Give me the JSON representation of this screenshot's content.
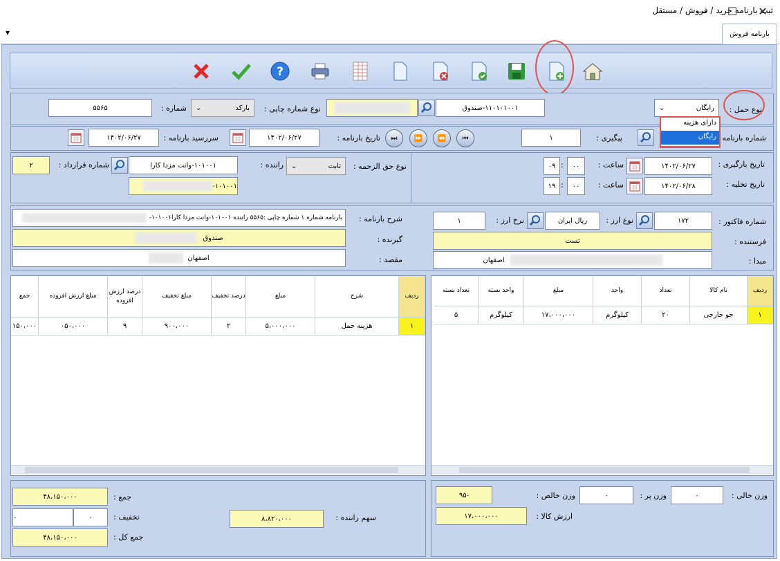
{
  "window": {
    "title": "ثبت بارنامه خرید / فروش / مستقل",
    "minimize": "—",
    "maximize": "☐",
    "close": "✕"
  },
  "tabs": {
    "active": "بارنامه فروش",
    "menu_arrow": "▾"
  },
  "toolbar": {
    "icons": [
      "home-icon",
      "new-document-icon",
      "save-icon",
      "approve-document-icon",
      "delete-document-icon",
      "document-icon",
      "table-icon",
      "print-icon",
      "help-icon",
      "confirm-icon",
      "cancel-icon"
    ]
  },
  "header": {
    "transport_type_label": "نوع حمل :",
    "transport_type_value": "رایگان",
    "transport_type_options": [
      "دارای هزینه",
      "رایگان"
    ],
    "account_value": "۱۱۰۱۰۱۰۰۱-صندوق",
    "print_number_type_label": "نوع شماره چاپی :",
    "print_number_type_value": "بارکد",
    "number_label": "شماره :",
    "number_value": "۵۵۶۵",
    "waybill_number_label": "شماره بارنامه :",
    "tracking_label": "پیگیری :",
    "tracking_value": "۱",
    "waybill_date_label": "تاریخ بارنامه :",
    "waybill_date_value": "۱۴۰۲/۰۶/۲۷",
    "due_date_label": "سررسید بارنامه :",
    "due_date_value": "۱۴۰۲/۰۶/۲۷"
  },
  "loading": {
    "load_date_label": "تاریخ بارگیری :",
    "load_date_value": "۱۴۰۲/۰۶/۲۷",
    "unload_date_label": "تاریخ تخلیه :",
    "unload_date_value": "۱۴۰۲/۰۶/۲۸",
    "hour_label": "ساعت :",
    "load_hour": "۰۹",
    "load_minute": "۰۰",
    "unload_hour": "۱۹",
    "unload_minute": "۰۰",
    "toll_type_label": "نوع حق الزحمه :",
    "toll_type_value": "ثابت",
    "driver_label": "راننده :",
    "driver_value": "۱۰۱۰۰۱-وانت مزدا کارا",
    "driver_account_value": "۱۰۱۰۰۱-",
    "contract_label": "شماره قرارداد :",
    "contract_value": "۲"
  },
  "details": {
    "invoice_label": "شماره فاکتور :",
    "invoice_value": "۱۷۲",
    "currency_type_label": "نوع ارز :",
    "currency_type_value": "ریال ایران",
    "currency_rate_label": "نرخ ارز :",
    "currency_rate_value": "۱",
    "sender_label": "فرستنده :",
    "sender_value": "تست",
    "origin_label": "مبدا :",
    "origin_value": "اصفهان",
    "description_label": "شرح بارنامه :",
    "description_value": "بارنامه شماره ۱ شماره چاپی :۵۵۶۵ راننده ۱۰۱۰۰۱-وانت مزدا کارا۱۰۱۰۰۱-",
    "receiver_label": "گیرنده :",
    "receiver_value": "صندوق",
    "destination_label": "مقصد :",
    "destination_value": "اصفهان"
  },
  "goods_table": {
    "headers": [
      "ردیف",
      "نام کالا",
      "تعداد",
      "واحد",
      "مبلغ",
      "واحد بسته",
      "تعداد بسته"
    ],
    "rows": [
      [
        "۱",
        "جو خارجی",
        "۲۰",
        "کیلوگرم",
        "۱۷،۰۰۰،۰۰۰",
        "کیلوگرم",
        "۵"
      ]
    ]
  },
  "costs_table": {
    "headers": [
      "ردیف",
      "شرح",
      "مبلغ",
      "درصد تخفیف",
      "مبلغ تخفیف",
      "درصد ارزش افزوده",
      "مبلغ ارزش افزوده",
      "جمع"
    ],
    "rows": [
      [
        "۱",
        "هزینه حمل",
        "۵،۰۰۰،۰۰۰",
        "۲",
        "۹۰۰،۰۰۰",
        "۹",
        "۰۵۰،۰۰۰",
        "۱۵۰،۰۰۰"
      ]
    ]
  },
  "weights": {
    "empty_label": "وزن خالی :",
    "empty_value": "۰",
    "full_label": "وزن پر :",
    "full_value": "۰",
    "net_label": "وزن خالص :",
    "net_value": "-۹۵",
    "goods_value_label": "ارزش کالا :",
    "goods_value": "۱۷،۰۰۰،۰۰۰"
  },
  "totals": {
    "sum_label": "جمع :",
    "sum_value": "۴۸،۱۵۰،۰۰۰",
    "discount_label": "تخفیف :",
    "discount_value": "۰",
    "discount_percent": "۰",
    "total_label": "جمع کل :",
    "total_value": "۴۸،۱۵۰،۰۰۰",
    "driver_share_label": "سهم راننده :",
    "driver_share_value": "۸،۸۲۰،۰۰۰"
  },
  "colors": {
    "panel": "#c6d5ec",
    "highlight": "#fbfab6",
    "annotation": "#e0524f",
    "selected_option": "#1e6fd9"
  }
}
